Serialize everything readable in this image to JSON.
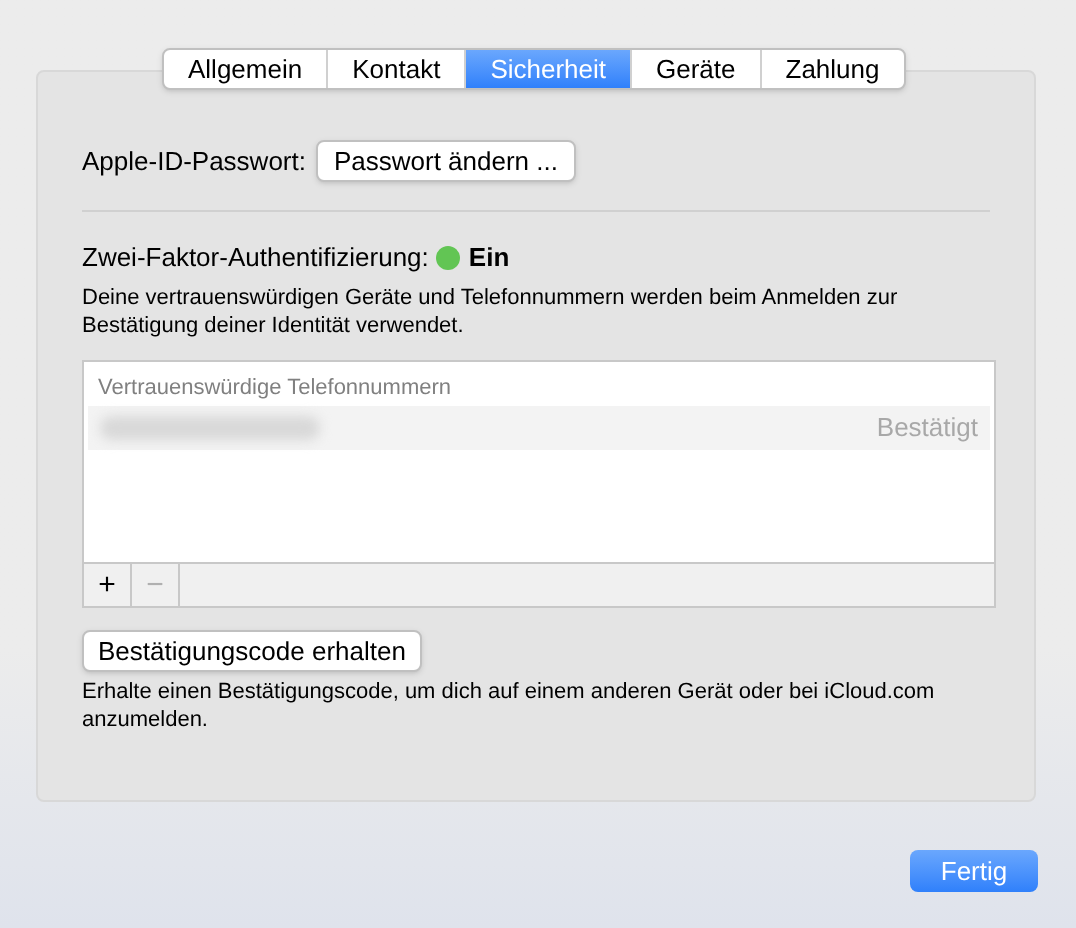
{
  "tabs": [
    {
      "label": "Allgemein",
      "selected": false
    },
    {
      "label": "Kontakt",
      "selected": false
    },
    {
      "label": "Sicherheit",
      "selected": true
    },
    {
      "label": "Geräte",
      "selected": false
    },
    {
      "label": "Zahlung",
      "selected": false
    }
  ],
  "password": {
    "label": "Apple-ID-Passwort:",
    "button": "Passwort ändern ..."
  },
  "two_factor": {
    "label": "Zwei-Faktor-Authentifizierung:",
    "on": true,
    "status": "Ein",
    "description": "Deine vertrauenswürdigen Geräte und Telefonnummern werden beim Anmelden zur Bestätigung deiner Identität verwendet."
  },
  "phone_list": {
    "header": "Vertrauenswürdige Telefonnummern",
    "rows": [
      {
        "status": "Bestätigt"
      }
    ],
    "buttons": [
      {
        "label": "+",
        "disabled": false
      },
      {
        "label": "−",
        "disabled": true
      }
    ]
  },
  "code": {
    "button": "Bestätigungscode erhalten",
    "description": "Erhalte einen Bestätigungscode, um dich auf einem anderen Gerät oder bei iCloud.com anzumelden."
  },
  "done_button": "Fertig"
}
